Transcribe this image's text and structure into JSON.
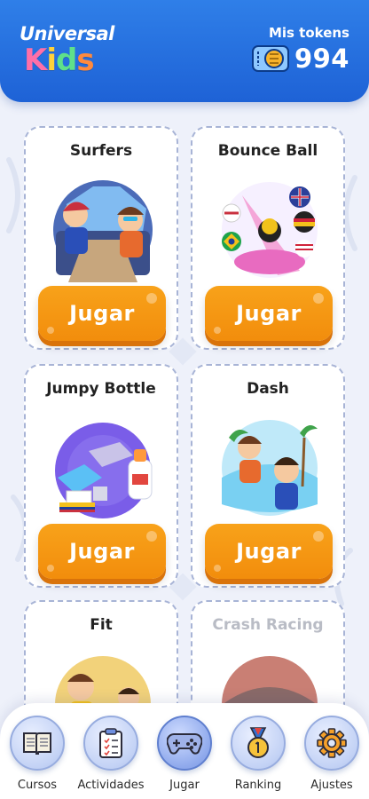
{
  "header": {
    "logo_line1": "Universal",
    "logo_line2": [
      "K",
      "i",
      "d",
      "s"
    ],
    "tokens_label": "Mis tokens",
    "tokens_value": "994"
  },
  "games": [
    {
      "title": "Surfers",
      "button": "Jugar",
      "icon": "surfers-game-art"
    },
    {
      "title": "Bounce Ball",
      "button": "Jugar",
      "icon": "bounce-ball-game-art"
    },
    {
      "title": "Jumpy Bottle",
      "button": "Jugar",
      "icon": "jumpy-bottle-game-art"
    },
    {
      "title": "Dash",
      "button": "Jugar",
      "icon": "dash-game-art"
    },
    {
      "title": "Fit",
      "button": "",
      "icon": "fit-game-art"
    },
    {
      "title": "Crash Racing",
      "button": "",
      "icon": "crash-racing-game-art"
    }
  ],
  "nav": {
    "items": [
      {
        "label": "Cursos",
        "icon": "book-icon"
      },
      {
        "label": "Actividades",
        "icon": "clipboard-icon"
      },
      {
        "label": "Jugar",
        "icon": "gamepad-icon"
      },
      {
        "label": "Ranking",
        "icon": "medal-icon"
      },
      {
        "label": "Ajustes",
        "icon": "gear-icon"
      }
    ],
    "active": "Jugar"
  },
  "colors": {
    "header": "#1e62d6",
    "button": "#f59a14",
    "card_border": "#a8b4d6",
    "disabled_title": "#b9bcc5"
  }
}
